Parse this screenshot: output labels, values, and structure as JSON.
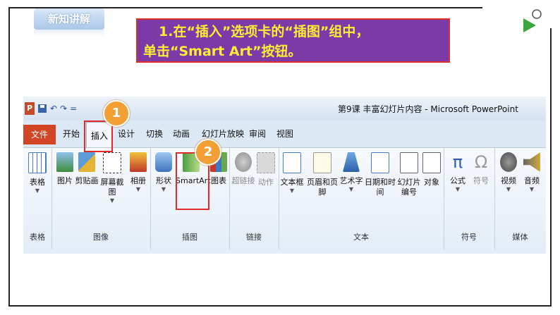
{
  "section_tag": "新知讲解",
  "instruction": {
    "line1": "1.在“插入”选项卡的“插图”组中，",
    "line2": "单击“Smart Art”按钮。"
  },
  "window_title": "第9课  丰富幻灯片内容 - Microsoft PowerPoint",
  "qat": {
    "logo": "P",
    "undo": "↶",
    "redo": "↷",
    "custom": "="
  },
  "tabs": [
    "文件",
    "开始",
    "插入",
    "设计",
    "切换",
    "动画",
    "幻灯片放映",
    "审阅",
    "视图"
  ],
  "groups": {
    "table": {
      "label": "表格",
      "cmds": [
        "表格"
      ]
    },
    "image": {
      "label": "图像",
      "cmds": [
        "图片",
        "剪贴画",
        "屏幕截图",
        "相册"
      ]
    },
    "illus": {
      "label": "插图",
      "cmds": [
        "形状",
        "SmartArt",
        "图表"
      ]
    },
    "links": {
      "label": "链接",
      "cmds": [
        "超链接",
        "动作"
      ]
    },
    "text": {
      "label": "文本",
      "cmds": [
        "文本框",
        "页眉和页脚",
        "艺术字",
        "日期和时间",
        "幻灯片",
        "编号",
        "对象"
      ]
    },
    "symbols": {
      "label": "符号",
      "cmds": [
        "公式",
        "符号"
      ]
    },
    "media": {
      "label": "媒体",
      "cmds": [
        "视频",
        "音频"
      ]
    }
  },
  "badges": [
    "1",
    "2"
  ],
  "colors": {
    "accent_purple": "#7b3aa8",
    "instruction_text": "#ffee33",
    "highlight_red": "#e12b2b",
    "badge_orange": "#f2a036",
    "file_tab": "#d24625"
  }
}
